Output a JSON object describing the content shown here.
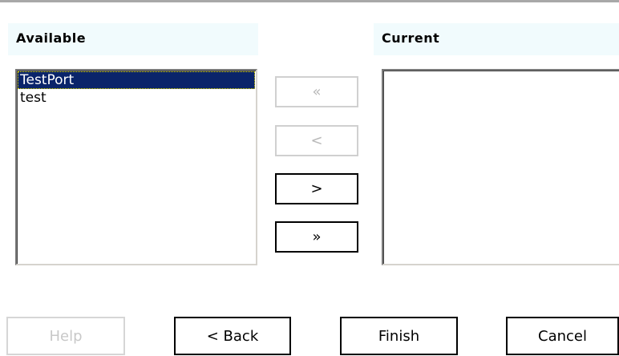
{
  "available": {
    "heading": "Available",
    "items": [
      {
        "label": "TestPort",
        "selected": true
      },
      {
        "label": "test",
        "selected": false
      }
    ]
  },
  "current": {
    "heading": "Current",
    "items": []
  },
  "move_buttons": {
    "remove_all": {
      "label": "«",
      "enabled": false
    },
    "remove": {
      "label": "<",
      "enabled": false
    },
    "add": {
      "label": ">",
      "enabled": true
    },
    "add_all": {
      "label": "»",
      "enabled": true
    }
  },
  "nav_buttons": {
    "help": {
      "label": "Help",
      "enabled": false
    },
    "back": {
      "label": "< Back",
      "enabled": true
    },
    "finish": {
      "label": "Finish",
      "enabled": true
    },
    "cancel": {
      "label": "Cancel",
      "enabled": true
    }
  },
  "colors": {
    "selection_background": "#0a246a",
    "heading_background": "#f1fbfd",
    "disabled_text": "#b8b8b8"
  }
}
